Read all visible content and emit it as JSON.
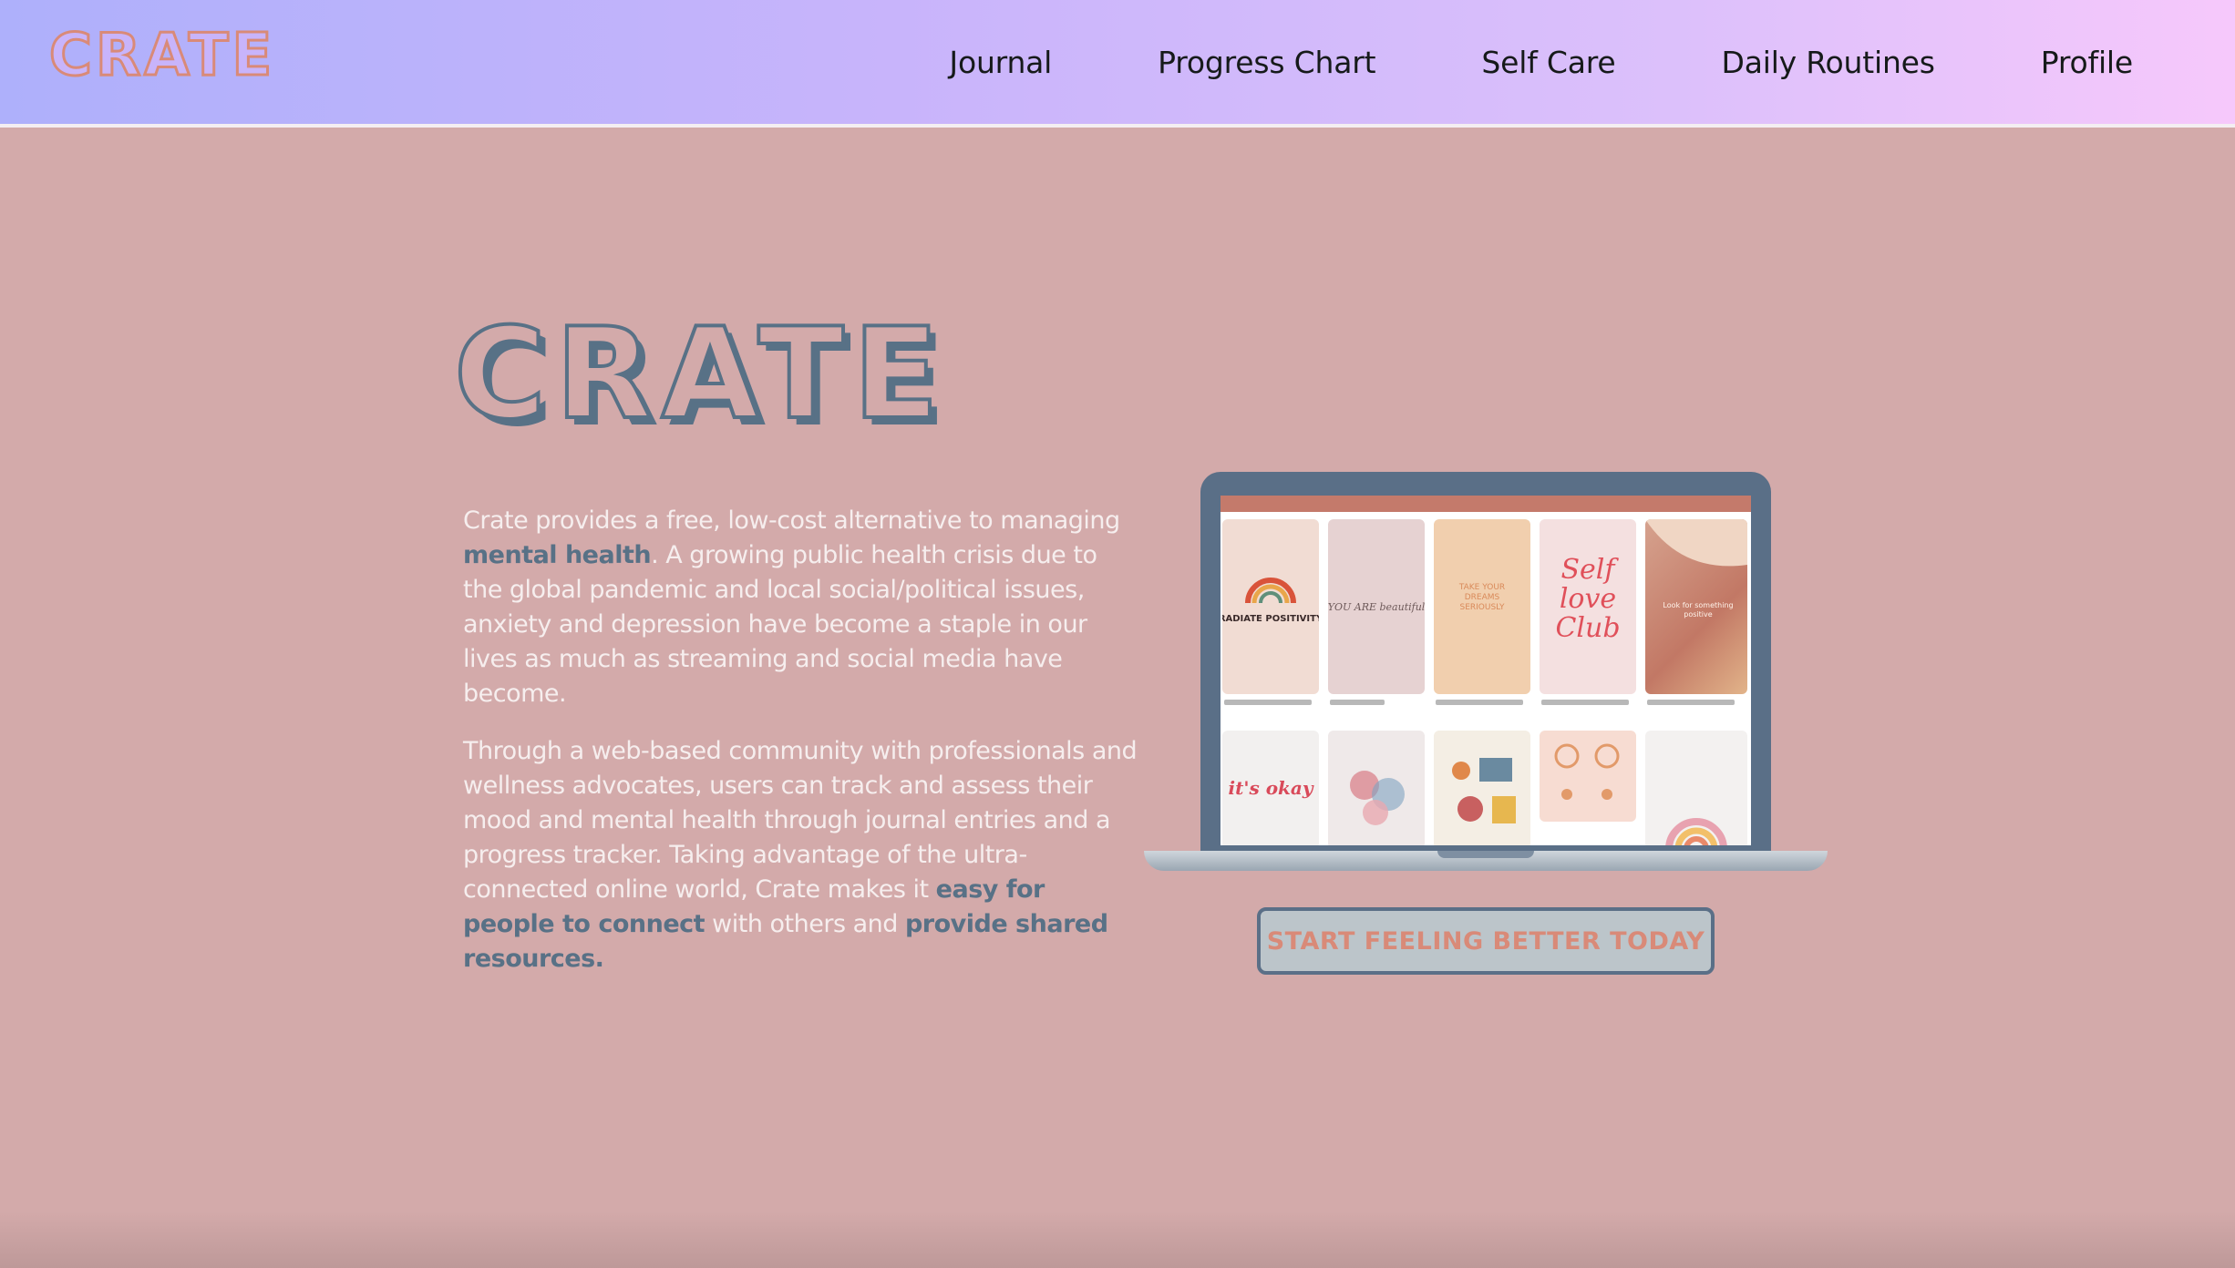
{
  "nav": {
    "logo_text": "CRATE",
    "links": [
      "Journal",
      "Progress Chart",
      "Self Care",
      "Daily Routines",
      "Profile"
    ]
  },
  "hero": {
    "logo_text": "CRATE",
    "para1": {
      "t1": "Crate provides a free, low-cost alternative to managing ",
      "h1": "mental health",
      "t2": ". A growing public health crisis due to the global pandemic and local social/political issues, anxiety and depression have become a staple in our lives as much as streaming and social media have become."
    },
    "para2": {
      "t1": "Through a web-based community with professionals and wellness advocates, users can track and assess their mood and mental health through journal entries and a progress tracker. Taking advantage of the ultra-connected online world, Crate makes it ",
      "h1": "easy for people to connect",
      "t2": " with others and ",
      "h2": "provide shared resources."
    },
    "cta_label": "START FEELING BETTER  TODAY"
  },
  "laptop_pins": {
    "row1": [
      "RADIATE POSITIVITY",
      "YOU ARE beautiful",
      "TAKE YOUR DREAMS SERIOUSLY",
      "Self love Club",
      "Look for something positive"
    ],
    "row2": [
      "it's okay",
      "",
      "",
      "",
      ""
    ]
  },
  "colors": {
    "background": "#d3aaaa",
    "logo_slate": "#587186",
    "logo_coral": "#d98a78",
    "nav_gradient_start": "#aeb0fb",
    "nav_gradient_end": "#f6c8fb"
  }
}
